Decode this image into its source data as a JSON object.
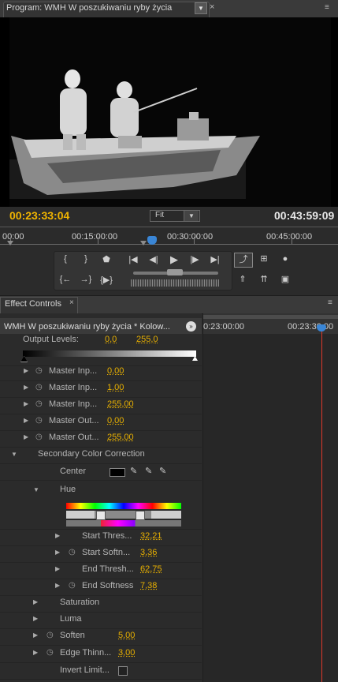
{
  "program": {
    "tab_title": "Program: WMH W poszukiwaniu ryby życia",
    "dropdown_icon": "chevron-down-icon",
    "close_symbol": "×",
    "menu_symbol": "≡",
    "playhead_timecode": "00:23:33:04",
    "zoom_label": "Fit",
    "duration_timecode": "00:43:59:09",
    "ruler_labels": [
      "00:00",
      "00:15:00:00",
      "00:30:00:00",
      "00:45:00:00"
    ],
    "playhead_position_fraction": 0.535,
    "colors": {
      "timecode": "#f0b400",
      "ruler_text": "#cfcfcf"
    }
  },
  "transport": {
    "buttons": [
      "mark-in-icon",
      "mark-out-icon",
      "add-marker-icon",
      "go-to-in-icon",
      "step-back-icon",
      "play-icon",
      "step-forward-icon",
      "go-to-out-icon",
      "clear-in-icon",
      "clear-out-icon",
      "play-in-to-out-icon",
      "loop-icon",
      "safe-margins-icon",
      "output-icon",
      "lift-icon",
      "extract-icon",
      "export-frame-icon"
    ]
  },
  "effect_controls": {
    "tab_title": "Effect Controls",
    "close_symbol": "×",
    "clip_title": "WMH W poszukiwaniu ryby życia * Kolow...",
    "timeline_labels": [
      "0:23:00:00",
      "00:23:30:00"
    ],
    "output_levels": {
      "label": "Output Levels:",
      "low": "0,0",
      "high": "255,0"
    },
    "master_rows": [
      {
        "label": "Master Inp...",
        "value": "0,00"
      },
      {
        "label": "Master Inp...",
        "value": "1,00"
      },
      {
        "label": "Master Inp...",
        "value": "255,00"
      },
      {
        "label": "Master Out...",
        "value": "0,00"
      },
      {
        "label": "Master Out...",
        "value": "255,00"
      }
    ],
    "secondary": {
      "title": "Secondary Color Correction",
      "center_label": "Center",
      "hue_label": "Hue",
      "hue_rows": [
        {
          "label": "Start Thres...",
          "value": "32,21",
          "stopwatch": false
        },
        {
          "label": "Start Softn...",
          "value": "3,36",
          "stopwatch": true
        },
        {
          "label": "End Thresh...",
          "value": "62,75",
          "stopwatch": false
        },
        {
          "label": "End Softness",
          "value": "7,38",
          "stopwatch": true
        }
      ],
      "saturation_label": "Saturation",
      "luma_label": "Luma",
      "soften": {
        "label": "Soften",
        "value": "5,00"
      },
      "edge_thinning": {
        "label": "Edge Thinn...",
        "value": "3,00"
      },
      "invert_label": "Invert Limit..."
    },
    "colors": {
      "value_text": "#e8b000",
      "playhead": "#e0392b"
    }
  }
}
